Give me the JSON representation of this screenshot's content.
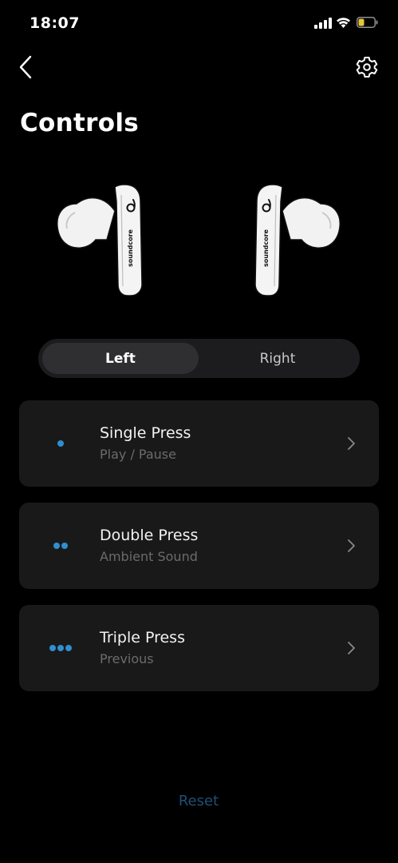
{
  "status_bar": {
    "time": "18:07",
    "battery_color": "#e8c33a"
  },
  "header": {
    "back_icon": "chevron-left-icon",
    "settings_icon": "gear-icon",
    "title": "Controls"
  },
  "earbuds": {
    "brand_text": "soundcore"
  },
  "side_selector": {
    "options": [
      "Left",
      "Right"
    ],
    "selected": "Left"
  },
  "controls": [
    {
      "title": "Single Press",
      "action": "Play / Pause",
      "dots": 1
    },
    {
      "title": "Double Press",
      "action": "Ambient Sound",
      "dots": 2
    },
    {
      "title": "Triple Press",
      "action": "Previous",
      "dots": 3
    }
  ],
  "reset_label": "Reset",
  "colors": {
    "accent": "#2e8fd0",
    "reset": "#1f4f73",
    "card_bg": "#19191a",
    "subtext": "#6b6b6f"
  }
}
